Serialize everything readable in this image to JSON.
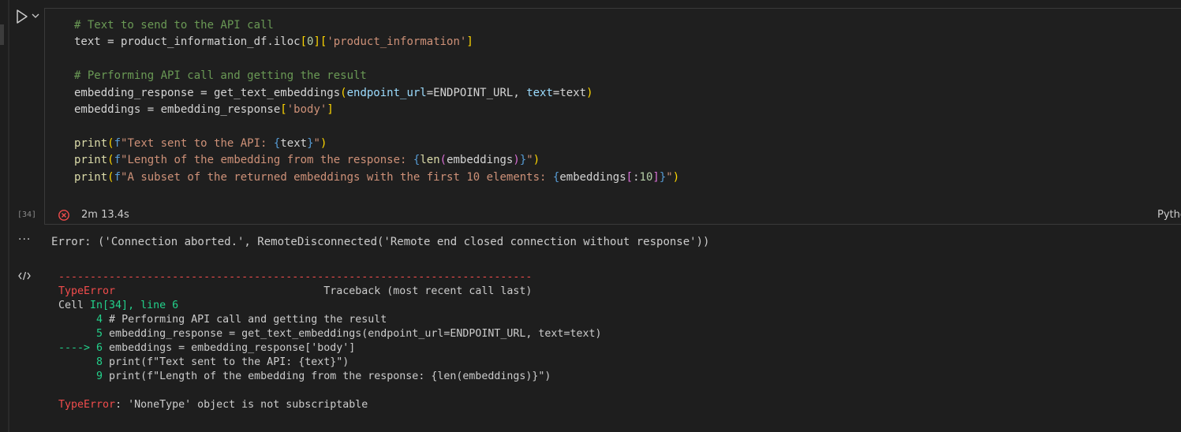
{
  "cell": {
    "execution_count": "[34]",
    "duration": "2m 13.4s",
    "language": "Python",
    "code_lines": [
      [
        {
          "t": "# Text to send to the API call",
          "c": "cm"
        }
      ],
      [
        {
          "t": "text = product_information_df.iloc"
        },
        {
          "t": "[",
          "c": "p1"
        },
        {
          "t": "0",
          "c": "num"
        },
        {
          "t": "]",
          "c": "p1"
        },
        {
          "t": "[",
          "c": "p1"
        },
        {
          "t": "'product_information'",
          "c": "str"
        },
        {
          "t": "]",
          "c": "p1"
        }
      ],
      [],
      [
        {
          "t": "# Performing API call and getting the result",
          "c": "cm"
        }
      ],
      [
        {
          "t": "embedding_response = get_text_embeddings"
        },
        {
          "t": "(",
          "c": "p1"
        },
        {
          "t": "endpoint_url",
          "c": "var"
        },
        {
          "t": "=ENDPOINT_URL, "
        },
        {
          "t": "text",
          "c": "var"
        },
        {
          "t": "=text"
        },
        {
          "t": ")",
          "c": "p1"
        }
      ],
      [
        {
          "t": "embeddings = embedding_response"
        },
        {
          "t": "[",
          "c": "p1"
        },
        {
          "t": "'body'",
          "c": "str"
        },
        {
          "t": "]",
          "c": "p1"
        }
      ],
      [],
      [
        {
          "t": "print",
          "c": "fn"
        },
        {
          "t": "(",
          "c": "p1"
        },
        {
          "t": "f",
          "c": "kw"
        },
        {
          "t": "\"Text sent to the API: ",
          "c": "str"
        },
        {
          "t": "{",
          "c": "kw"
        },
        {
          "t": "text"
        },
        {
          "t": "}",
          "c": "kw"
        },
        {
          "t": "\"",
          "c": "str"
        },
        {
          "t": ")",
          "c": "p1"
        }
      ],
      [
        {
          "t": "print",
          "c": "fn"
        },
        {
          "t": "(",
          "c": "p1"
        },
        {
          "t": "f",
          "c": "kw"
        },
        {
          "t": "\"Length of the embedding from the response: ",
          "c": "str"
        },
        {
          "t": "{",
          "c": "kw"
        },
        {
          "t": "len",
          "c": "fn"
        },
        {
          "t": "(",
          "c": "p2"
        },
        {
          "t": "embeddings"
        },
        {
          "t": ")",
          "c": "p2"
        },
        {
          "t": "}",
          "c": "kw"
        },
        {
          "t": "\"",
          "c": "str"
        },
        {
          "t": ")",
          "c": "p1"
        }
      ],
      [
        {
          "t": "print",
          "c": "fn"
        },
        {
          "t": "(",
          "c": "p1"
        },
        {
          "t": "f",
          "c": "kw"
        },
        {
          "t": "\"A subset of the returned embeddings with the first 10 elements: ",
          "c": "str"
        },
        {
          "t": "{",
          "c": "kw"
        },
        {
          "t": "embeddings"
        },
        {
          "t": "[",
          "c": "p2"
        },
        {
          "t": ":",
          "c": ""
        },
        {
          "t": "10",
          "c": "num"
        },
        {
          "t": "]",
          "c": "p2"
        },
        {
          "t": "}",
          "c": "kw"
        },
        {
          "t": "\"",
          "c": "str"
        },
        {
          "t": ")",
          "c": "p1"
        }
      ]
    ]
  },
  "output": {
    "more_label": "···",
    "error_line": "Error: ('Connection aborted.', RemoteDisconnected('Remote end closed connection without response'))",
    "traceback": [
      [
        {
          "t": "---------------------------------------------------------------------------",
          "c": "red"
        }
      ],
      [
        {
          "t": "TypeError",
          "c": "red"
        },
        {
          "t": "                                 Traceback (most recent call last)"
        }
      ],
      [
        {
          "t": "Cell "
        },
        {
          "t": "In[34], line 6",
          "c": "grn"
        }
      ],
      [
        {
          "t": "      4",
          "c": "grn"
        },
        {
          "t": " # Performing API call and getting the result"
        }
      ],
      [
        {
          "t": "      5",
          "c": "grn"
        },
        {
          "t": " embedding_response = get_text_embeddings(endpoint_url=ENDPOINT_URL, text=text)"
        }
      ],
      [
        {
          "t": "----> 6",
          "c": "grn"
        },
        {
          "t": " embeddings = embedding_response['body']"
        }
      ],
      [
        {
          "t": "      8",
          "c": "grn"
        },
        {
          "t": " print(f\"Text sent to the API: {text}\")"
        }
      ],
      [
        {
          "t": "      9",
          "c": "grn"
        },
        {
          "t": " print(f\"Length of the embedding from the response: {len(embeddings)}\")"
        }
      ],
      [],
      [
        {
          "t": "TypeError",
          "c": "red"
        },
        {
          "t": ": 'NoneType' object is not subscriptable"
        }
      ]
    ]
  },
  "colors": {
    "background": "#1e1e1e",
    "error_red": "#f14c4c",
    "traceback_green": "#23d18b"
  },
  "icons": {
    "run": "play-icon",
    "run_menu": "chevron-down-icon",
    "status": "error-circle-icon",
    "output_type": "code-icon"
  }
}
